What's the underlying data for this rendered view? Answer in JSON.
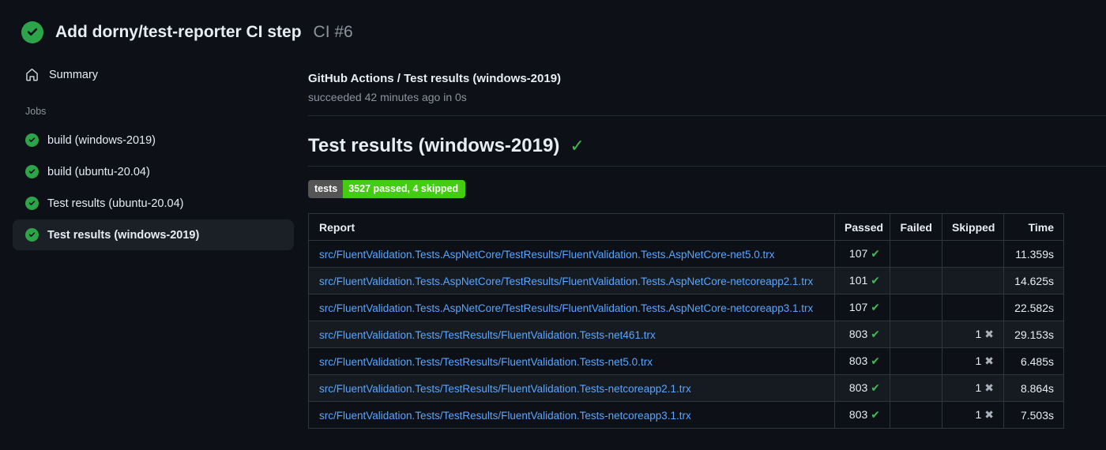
{
  "header": {
    "title": "Add dorny/test-reporter CI step",
    "run_number": "CI #6",
    "status": "success"
  },
  "sidebar": {
    "summary_label": "Summary",
    "jobs_label": "Jobs",
    "jobs": [
      {
        "label": "build (windows-2019)",
        "status": "success",
        "selected": false
      },
      {
        "label": "build (ubuntu-20.04)",
        "status": "success",
        "selected": false
      },
      {
        "label": "Test results (ubuntu-20.04)",
        "status": "success",
        "selected": false
      },
      {
        "label": "Test results (windows-2019)",
        "status": "success",
        "selected": true
      }
    ]
  },
  "main": {
    "check_title": "GitHub Actions / Test results (windows-2019)",
    "check_status": "succeeded 42 minutes ago in 0s",
    "section_heading": "Test results (windows-2019)",
    "badge": {
      "label": "tests",
      "value": "3527 passed, 4 skipped"
    },
    "table": {
      "columns": [
        "Report",
        "Passed",
        "Failed",
        "Skipped",
        "Time"
      ],
      "rows": [
        {
          "report": "src/FluentValidation.Tests.AspNetCore/TestResults/FluentValidation.Tests.AspNetCore-net5.0.trx",
          "passed": "107",
          "failed": "",
          "skipped": "",
          "time": "11.359s"
        },
        {
          "report": "src/FluentValidation.Tests.AspNetCore/TestResults/FluentValidation.Tests.AspNetCore-netcoreapp2.1.trx",
          "passed": "101",
          "failed": "",
          "skipped": "",
          "time": "14.625s"
        },
        {
          "report": "src/FluentValidation.Tests.AspNetCore/TestResults/FluentValidation.Tests.AspNetCore-netcoreapp3.1.trx",
          "passed": "107",
          "failed": "",
          "skipped": "",
          "time": "22.582s"
        },
        {
          "report": "src/FluentValidation.Tests/TestResults/FluentValidation.Tests-net461.trx",
          "passed": "803",
          "failed": "",
          "skipped": "1",
          "time": "29.153s"
        },
        {
          "report": "src/FluentValidation.Tests/TestResults/FluentValidation.Tests-net5.0.trx",
          "passed": "803",
          "failed": "",
          "skipped": "1",
          "time": "6.485s"
        },
        {
          "report": "src/FluentValidation.Tests/TestResults/FluentValidation.Tests-netcoreapp2.1.trx",
          "passed": "803",
          "failed": "",
          "skipped": "1",
          "time": "8.864s"
        },
        {
          "report": "src/FluentValidation.Tests/TestResults/FluentValidation.Tests-netcoreapp3.1.trx",
          "passed": "803",
          "failed": "",
          "skipped": "1",
          "time": "7.503s"
        }
      ]
    }
  },
  "icons": {
    "passed_glyph": "✔",
    "skipped_glyph": "✖"
  },
  "colors": {
    "background": "#0d1117",
    "link": "#58a6ff",
    "success_green": "#3fb950",
    "badge_label_bg": "#555555",
    "badge_value_bg": "#44cc11",
    "table_border": "#30363d"
  }
}
